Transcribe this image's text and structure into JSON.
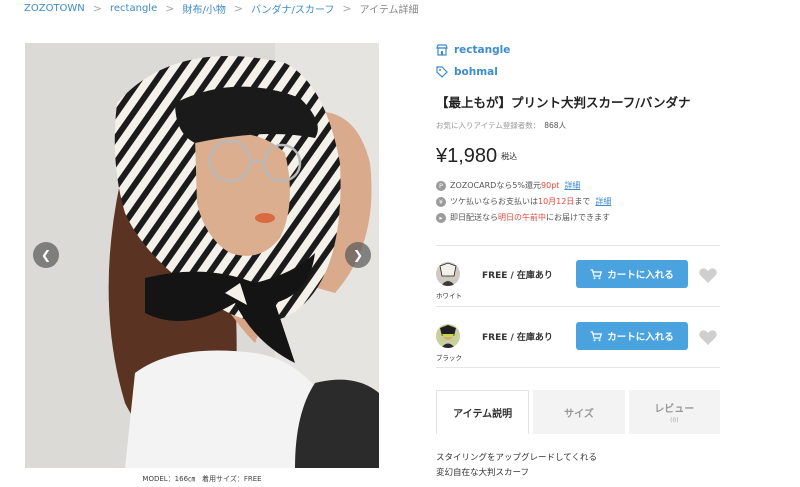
{
  "breadcrumb": [
    "ZOZOTOWN",
    "rectangle",
    "財布/小物",
    "バンダナ/スカーフ",
    "アイテム詳細"
  ],
  "gallery": {
    "caption": "MODEL：166㎝　着用サイズ：FREE",
    "prev_icon": "chevron-left-icon",
    "next_icon": "chevron-right-icon"
  },
  "product": {
    "shop": "rectangle",
    "brand": "bohmal",
    "title": "【最上もが】プリント大判スカーフ/バンダナ",
    "fav_label": "お気に入りアイテム登録者数：",
    "fav_count": "868人",
    "price": "¥1,980",
    "tax": "税込"
  },
  "info": [
    {
      "icon": "P",
      "pre": "ZOZOCARDなら5%還元",
      "red": "90pt",
      "post": "",
      "link": "詳細"
    },
    {
      "icon": "¥",
      "pre": "ツケ払いならお支払いは",
      "red": "10月12日",
      "post": "まで",
      "link": "詳細"
    },
    {
      "icon": "▸",
      "pre": "即日配送なら",
      "red": "明日の午前中",
      "post": "にお届けできます",
      "link": ""
    }
  ],
  "variants": [
    {
      "color": "ホワイト",
      "stock": "FREE / 在庫あり",
      "cart": "カートに入れる"
    },
    {
      "color": "ブラック",
      "stock": "FREE / 在庫あり",
      "cart": "カートに入れる"
    }
  ],
  "tabs": [
    {
      "label": "アイテム説明",
      "sub": ""
    },
    {
      "label": "サイズ",
      "sub": ""
    },
    {
      "label": "レビュー",
      "sub": "(0)"
    }
  ],
  "description": [
    "スタイリングをアップグレードしてくれる",
    "変幻自在な大判スカーフ"
  ],
  "colors": {
    "link": "#3d8ccb",
    "accent": "#4aa3df",
    "highlight": "#e0483e"
  }
}
